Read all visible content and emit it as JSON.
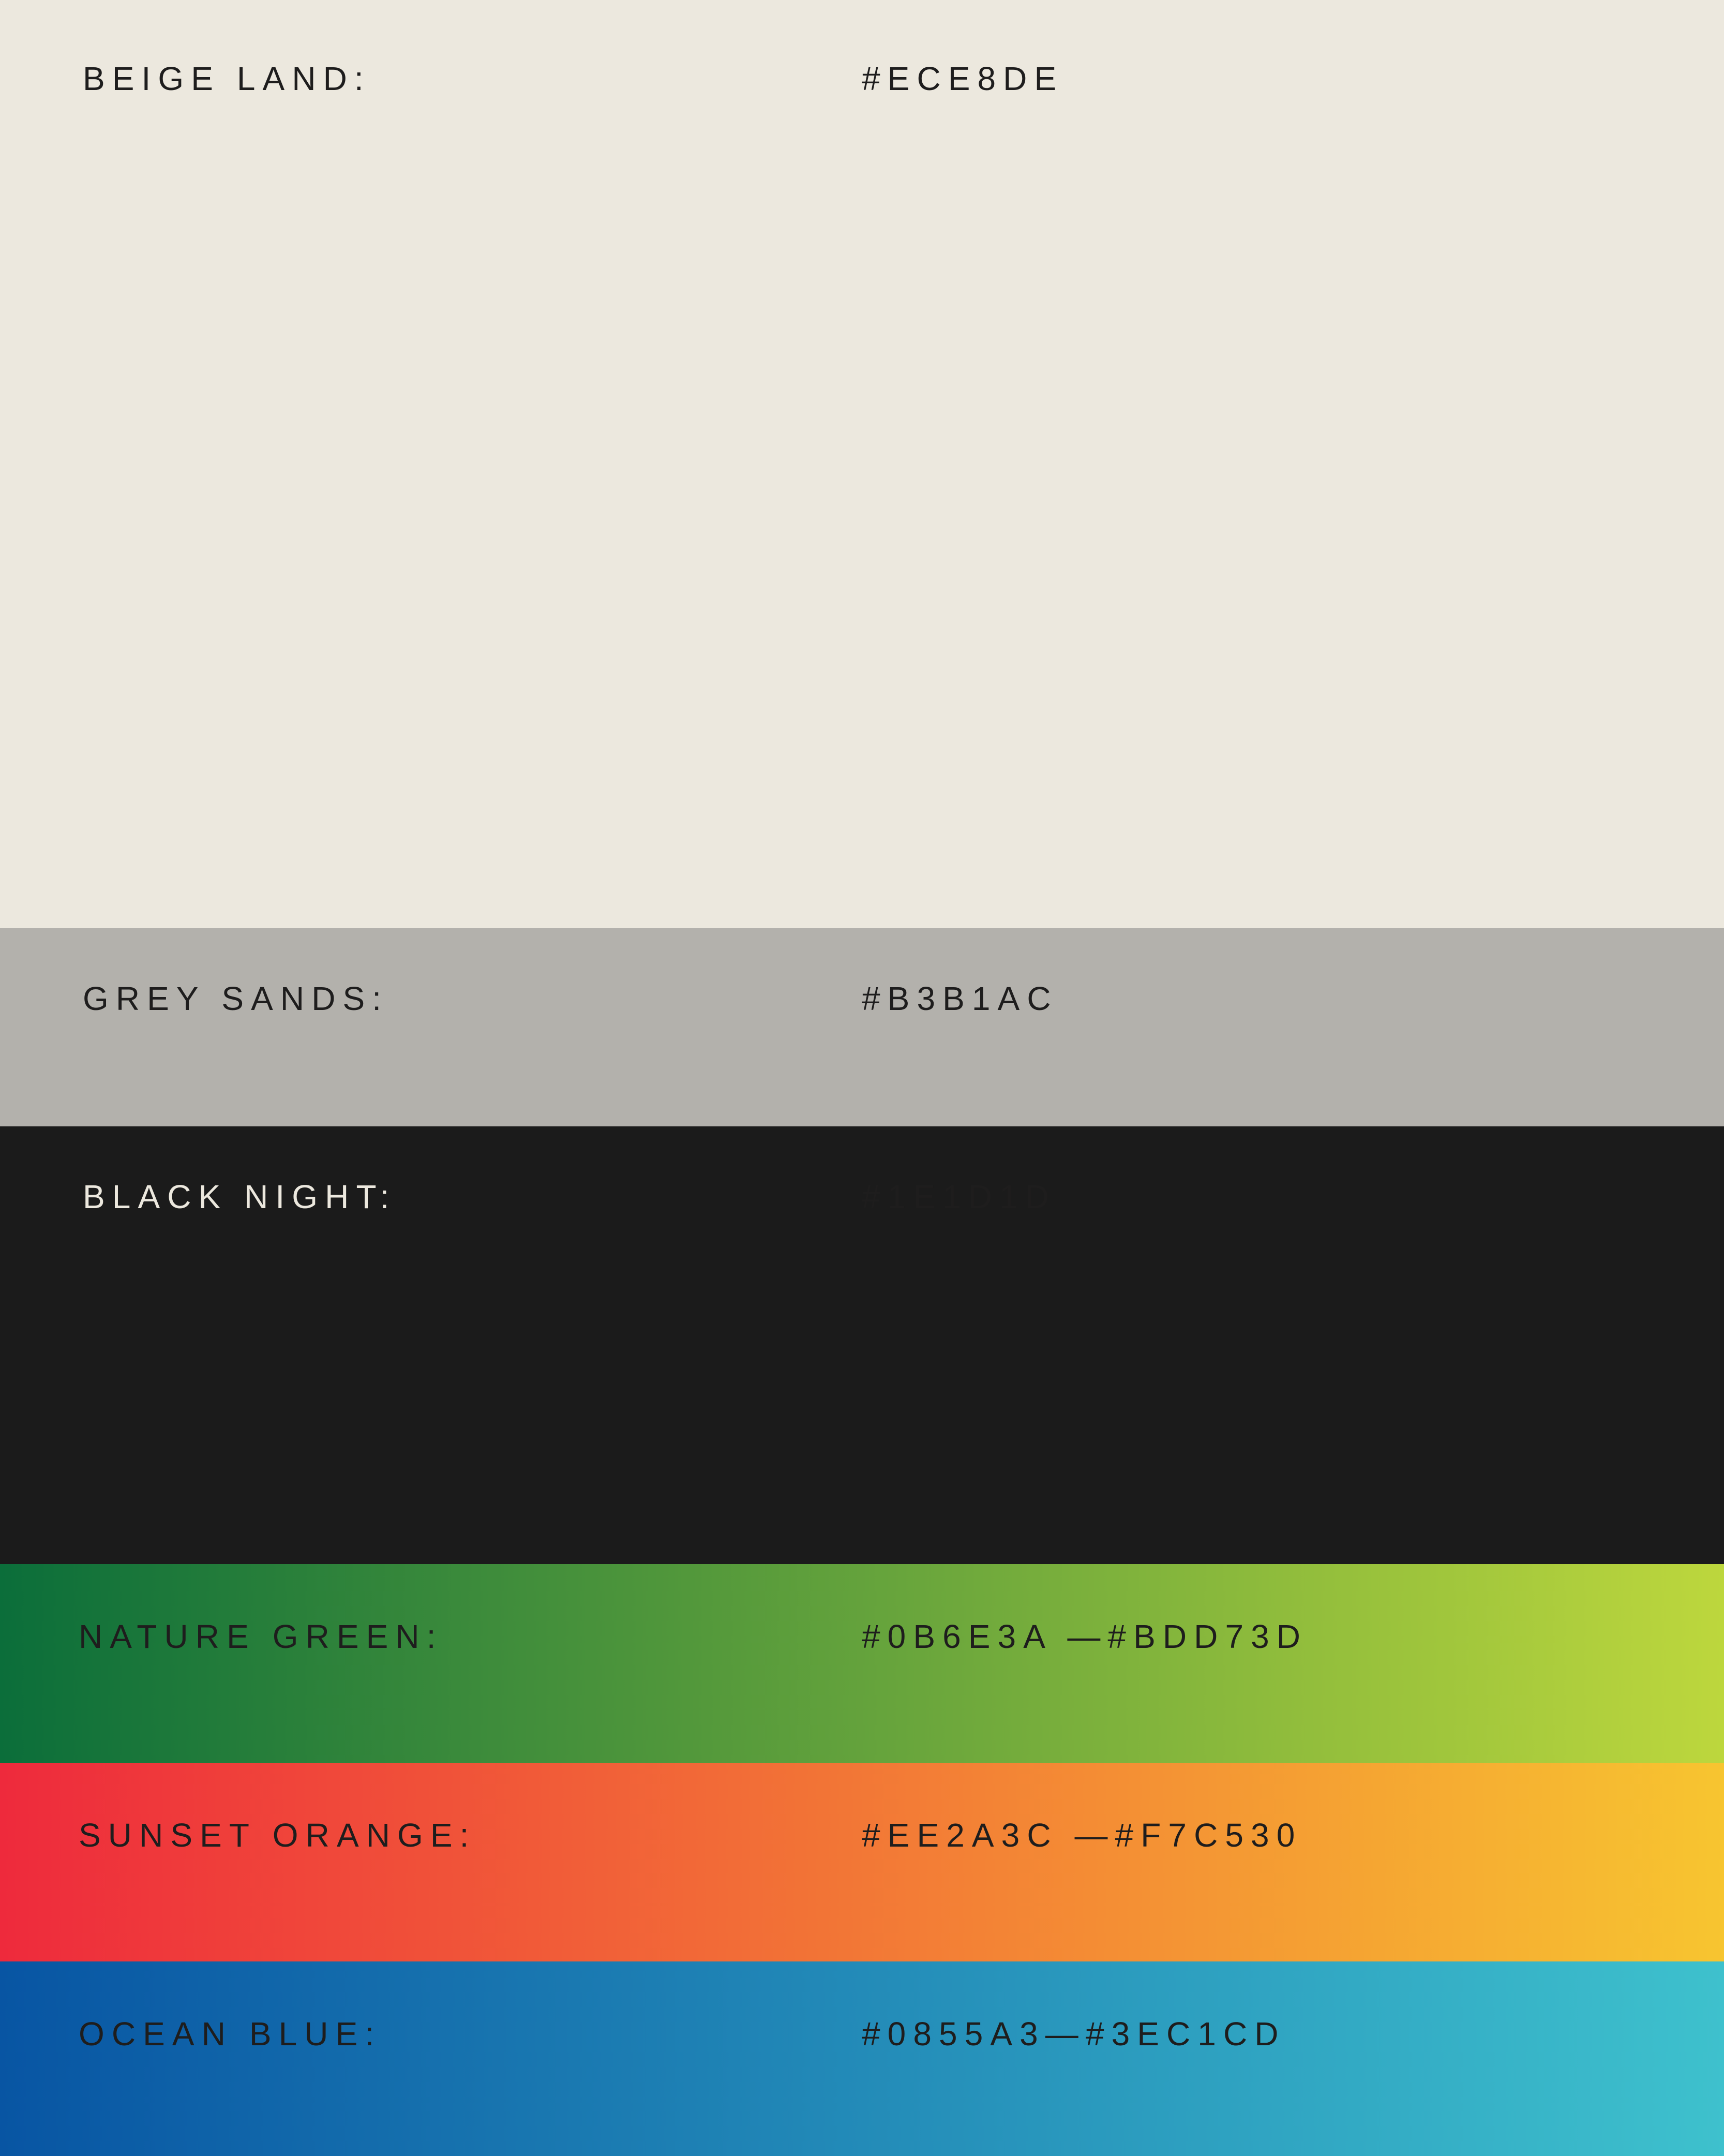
{
  "swatches": [
    {
      "name": "BEIGE LAND:",
      "code": "#ECE8DE",
      "colors": [
        "#ECE8DE"
      ]
    },
    {
      "name": "GREY SANDS:",
      "code": "#B3B1AC",
      "colors": [
        "#B3B1AC"
      ]
    },
    {
      "name": "BLACK NIGHT:",
      "code": "#1E1D1D",
      "colors": [
        "#1E1D1D"
      ]
    },
    {
      "name": "NATURE GREEN:",
      "code": "#0B6E3A —#BDD73D",
      "colors": [
        "#0B6E3A",
        "#BDD73D"
      ]
    },
    {
      "name": "SUNSET ORANGE:",
      "code": "#EE2A3C —#F7C530",
      "colors": [
        "#EE2A3C",
        "#F7C530"
      ]
    },
    {
      "name": "OCEAN BLUE:",
      "code": "#0855A3—#3EC1CD",
      "colors": [
        "#0855A3",
        "#3EC1CD"
      ]
    }
  ]
}
